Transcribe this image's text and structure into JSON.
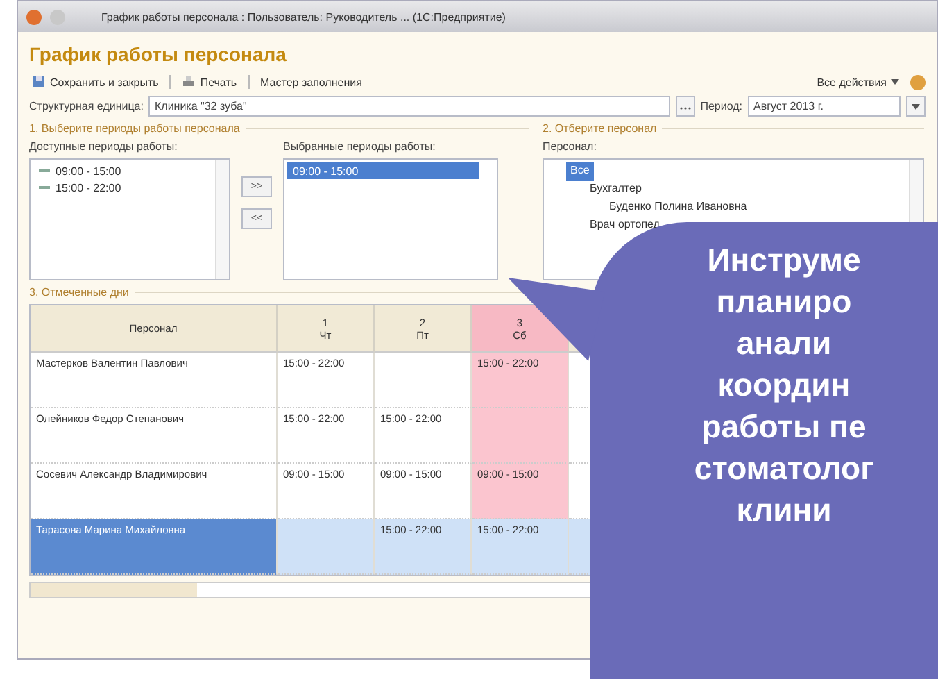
{
  "window": {
    "title": "График работы персонала : Пользователь: Руководитель ... (1С:Предприятие)"
  },
  "form_title": "График работы персонала",
  "toolbar": {
    "buttons": [
      {
        "label": "Сохранить и закрыть",
        "kind": "save"
      },
      {
        "label": "Печать",
        "kind": "print"
      },
      {
        "label": "Мастер заполнения",
        "kind": "plain"
      }
    ],
    "all_actions": "Все действия"
  },
  "fields": {
    "unit_label": "Структурная единица:",
    "unit_value": "Клиника \"32 зуба\"",
    "period_label": "Период:",
    "period_value": "Август 2013 г."
  },
  "section_1": {
    "title": "1. Выберите периоды работы персонала",
    "available_label": "Доступные периоды работы:",
    "available": [
      {
        "label": "09:00 - 15:00",
        "selected": false
      },
      {
        "label": "15:00 - 22:00",
        "selected": false
      }
    ],
    "move_buttons": [
      ">>",
      "<<"
    ],
    "chosen_label": "Выбранные периоды работы:",
    "chosen": [
      {
        "label": "09:00 - 15:00",
        "selected": true
      }
    ]
  },
  "section_2": {
    "title": "2. Отберите персонал",
    "staff_label": "Персонал:",
    "tree": [
      {
        "label": "Все",
        "selected": true,
        "children": [
          {
            "label": "Бухгалтер",
            "selected": false,
            "children": [
              {
                "label": "Буденко Полина Ивановна",
                "selected": false
              }
            ]
          },
          {
            "label": "Врач ортопед",
            "selected": false
          }
        ]
      }
    ]
  },
  "section_3": {
    "title": "3. Отмеченные дни",
    "first_column": "Персонал",
    "days": [
      {
        "day": "1",
        "weekday": "Чт",
        "weekend": false
      },
      {
        "day": "2",
        "weekday": "Пт",
        "weekend": false
      },
      {
        "day": "3",
        "weekday": "Сб",
        "weekend": true
      }
    ],
    "rows": [
      {
        "name": "Мастерков Валентин Павлович",
        "selected": false,
        "cells": [
          "15:00 - 22:00",
          null,
          "15:00 - 22:00"
        ]
      },
      {
        "name": "Олейников Федор Степанович",
        "selected": false,
        "cells": [
          "15:00 - 22:00",
          "15:00 - 22:00",
          null
        ]
      },
      {
        "name": "Сосевич Александр Владимирович",
        "selected": false,
        "cells": [
          "09:00 - 15:00",
          "09:00 - 15:00",
          "09:00 - 15:00"
        ]
      },
      {
        "name": "Тарасова Марина Михайловна",
        "selected": true,
        "cells": [
          null,
          "15:00 - 22:00",
          "15:00 - 22:00"
        ]
      }
    ]
  },
  "callout": {
    "lines": [
      "Инструме",
      "планиро",
      "анали",
      "координ",
      "работы пе",
      "стоматолог",
      "клини"
    ]
  }
}
